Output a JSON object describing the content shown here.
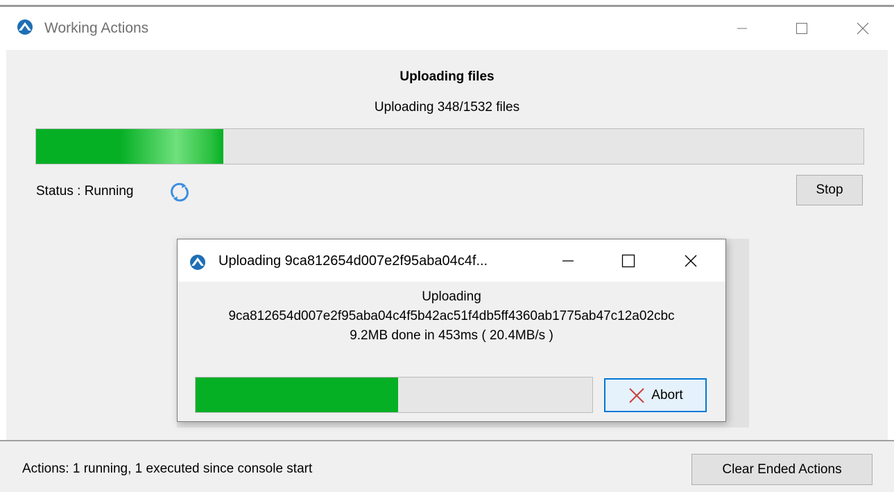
{
  "main_window": {
    "title": "Working Actions",
    "app_icon": "app-logo-icon",
    "controls": {
      "minimize_icon": "minimize-icon",
      "maximize_icon": "maximize-icon",
      "close_icon": "close-icon"
    },
    "heading": "Uploading files",
    "subheading": "Uploading 348/1532 files",
    "progress_fraction": 0.226,
    "status_label": "Status : Running",
    "status_icon": "refresh-spinner-icon",
    "stop_label": "Stop",
    "footer_text": "Actions: 1 running, 1 executed since console start",
    "clear_label": "Clear Ended Actions"
  },
  "dialog": {
    "title": "Uploading 9ca812654d007e2f95aba04c4f...",
    "app_icon": "app-logo-icon",
    "controls": {
      "minimize_icon": "minimize-icon",
      "maximize_icon": "maximize-icon",
      "close_icon": "close-icon"
    },
    "line1": "Uploading",
    "line2": "9ca812654d007e2f95aba04c4f5b42ac51f4db5ff4360ab1775ab47c12a02cbc",
    "line3": "9.2MB done in 453ms ( 20.4MB/s )",
    "progress_fraction": 0.51,
    "abort_label": "Abort",
    "abort_icon": "x-cross-icon"
  },
  "colors": {
    "progress_green": "#06b025",
    "accent_blue": "#0078d7",
    "spinner_blue": "#3b8de0",
    "abort_cross_red": "#c9413a",
    "logo_blue": "#1f6fb5"
  }
}
